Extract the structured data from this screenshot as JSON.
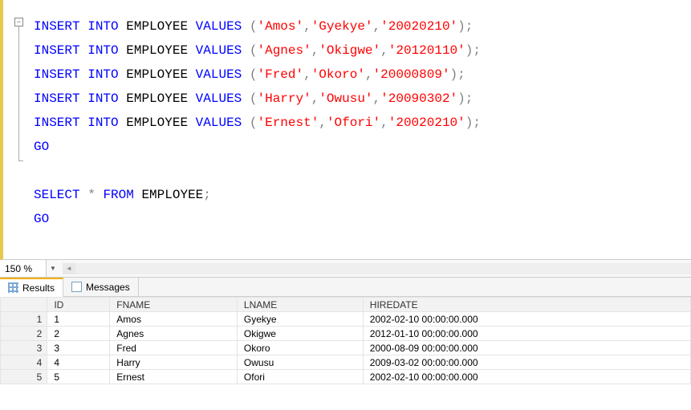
{
  "zoom": "150 %",
  "tabs": {
    "results": "Results",
    "messages": "Messages"
  },
  "sql": {
    "kw_insert": "INSERT",
    "kw_into": "INTO",
    "obj": "EMPLOYEE",
    "kw_values": "VALUES",
    "kw_go": "GO",
    "kw_select": "SELECT",
    "kw_from": "FROM",
    "star": "*",
    "semi": ";",
    "op": "(",
    "cp": ")",
    "c": ",",
    "rows": [
      {
        "a": "'Amos'",
        "b": "'Gyekye'",
        "c": "'20020210'"
      },
      {
        "a": "'Agnes'",
        "b": "'Okigwe'",
        "c": "'20120110'"
      },
      {
        "a": "'Fred'",
        "b": "'Okoro'",
        "c": "'20000809'"
      },
      {
        "a": "'Harry'",
        "b": "'Owusu'",
        "c": "'20090302'"
      },
      {
        "a": "'Ernest'",
        "b": "'Ofori'",
        "c": "'20020210'"
      }
    ]
  },
  "results": {
    "columns": [
      "ID",
      "FNAME",
      "LNAME",
      "HIREDATE"
    ],
    "rows": [
      {
        "n": "1",
        "id": "1",
        "fname": "Amos",
        "lname": "Gyekye",
        "hiredate": "2002-02-10 00:00:00.000"
      },
      {
        "n": "2",
        "id": "2",
        "fname": "Agnes",
        "lname": "Okigwe",
        "hiredate": "2012-01-10 00:00:00.000"
      },
      {
        "n": "3",
        "id": "3",
        "fname": "Fred",
        "lname": "Okoro",
        "hiredate": "2000-08-09 00:00:00.000"
      },
      {
        "n": "4",
        "id": "4",
        "fname": "Harry",
        "lname": "Owusu",
        "hiredate": "2009-03-02 00:00:00.000"
      },
      {
        "n": "5",
        "id": "5",
        "fname": "Ernest",
        "lname": "Ofori",
        "hiredate": "2002-02-10 00:00:00.000"
      }
    ]
  }
}
